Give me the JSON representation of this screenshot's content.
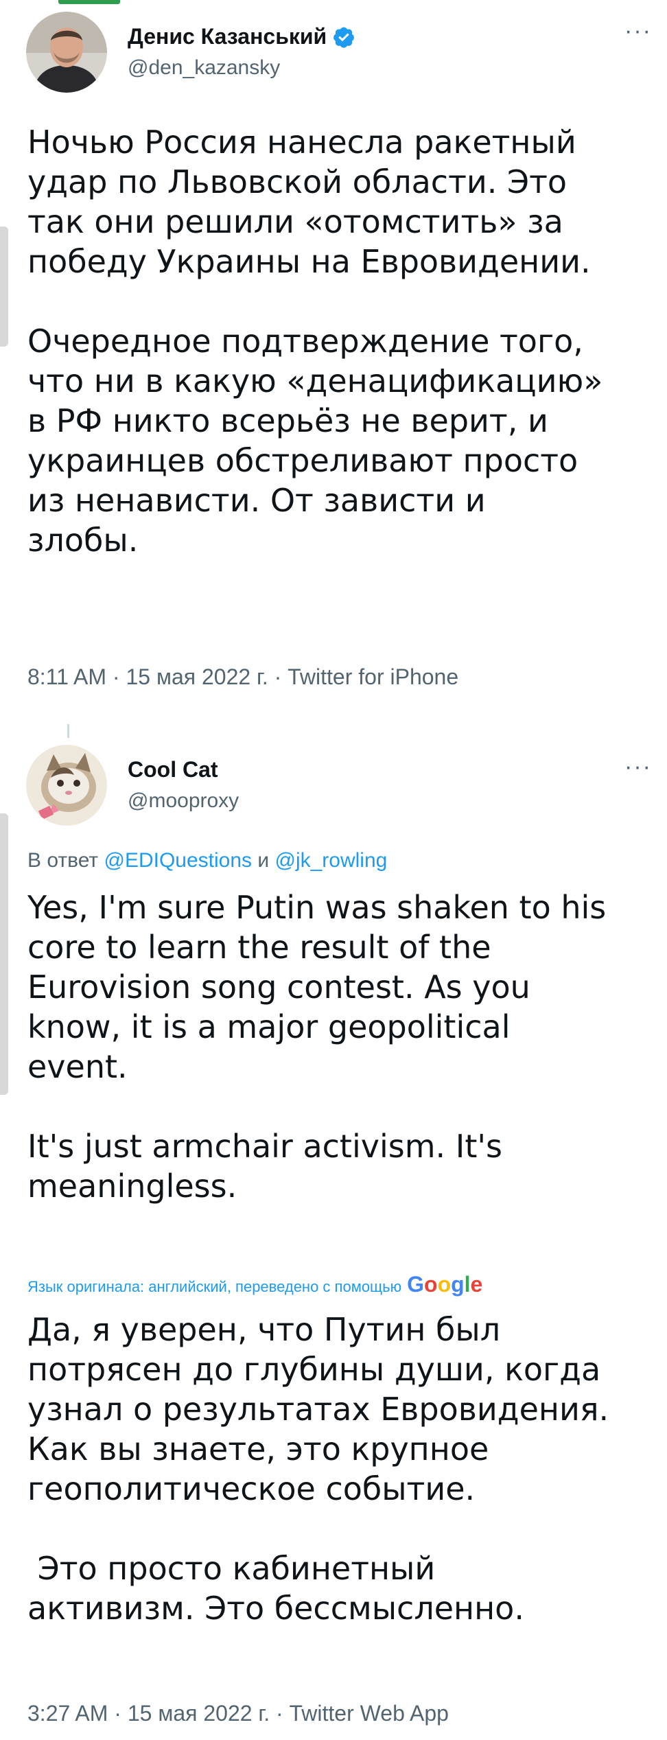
{
  "colors": {
    "accent": "#1d9bf0",
    "text": "#0f1419",
    "secondary": "#536471"
  },
  "tweet1": {
    "author_name": "Денис Казанський",
    "handle": "@den_kazansky",
    "verified": true,
    "more_icon": "more-icon",
    "text": "Ночью Россия нанесла ракетный\nудар по Львовской области. Это\nтак они решили «отомстить» за\nпобеду Украины на Евровидении.\n\nОчередное подтверждение того,\nчто ни в какую «денацификацию»\nв РФ никто всерьёз не верит, и\nукраинцев обстреливают просто\nиз ненависти. От зависти и\nзлобы.",
    "meta": "8:11 AM · 15 мая 2022 г. · Twitter for iPhone"
  },
  "tweet2": {
    "author_name": "Cool Cat",
    "handle": "@mooproxy",
    "more_icon": "more-icon",
    "reply_prefix": "В ответ",
    "reply_mention1": "@EDIQuestions",
    "reply_and": "и",
    "reply_mention2": "@jk_rowling",
    "text": "Yes, I'm sure Putin was shaken to his\ncore to learn the result of the\nEurovision song contest. As you\nknow, it is a major geopolitical\nevent.\n\nIt's just armchair activism. It's\nmeaningless.",
    "translation_note": "Язык оригинала: английский, переведено с помощью",
    "translation_provider": "Google",
    "translation": "Да, я уверен, что Путин был\nпотрясен до глубины души, когда\nузнал о результатах Евровидения.\nКак вы знаете, это крупное\nгеополитическое событие.\n\n Это просто кабинетный\nактивизм. Это бессмысленно.",
    "meta": "3:27 AM · 15 мая 2022 г. · Twitter Web App"
  }
}
